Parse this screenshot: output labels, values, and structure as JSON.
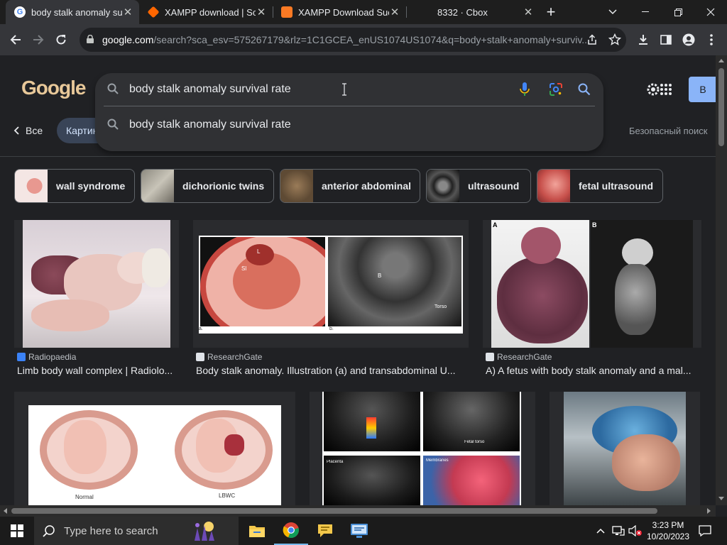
{
  "tabs": [
    {
      "title": "body stalk anomaly su",
      "close": "✕",
      "active": true
    },
    {
      "title": "XAMPP download | Sou",
      "close": "✕",
      "active": false
    },
    {
      "title": "XAMPP Download Succ",
      "close": "✕",
      "active": false
    },
    {
      "title": "8332 · Cbox",
      "close": "✕",
      "active": false
    }
  ],
  "new_tab_label": "+",
  "address_bar": {
    "domain": "google.com",
    "path": "/search?sca_esv=575267179&rlz=1C1GCEA_enUS1074US1074&q=body+stalk+anomaly+surviv..."
  },
  "search": {
    "query": "body stalk anomaly survival rate",
    "suggestion": "body stalk anomaly survival rate"
  },
  "nav": {
    "back": "Все",
    "images_tab": "Картинки",
    "safe_search": "Безопасный поиск",
    "signin": "В"
  },
  "logo_text": "Google",
  "chips": [
    {
      "label": "wall syndrome"
    },
    {
      "label": "dichorionic twins"
    },
    {
      "label": "anterior abdominal"
    },
    {
      "label": "ultrasound"
    },
    {
      "label": "fetal ultrasound"
    }
  ],
  "results": [
    {
      "source": "Radiopaedia",
      "caption": "Limb body wall complex | Radiolo..."
    },
    {
      "source": "ResearchGate",
      "caption": "Body stalk anomaly. Illustration (a) and transabdominal U..."
    },
    {
      "source": "ResearchGate",
      "caption": "A) A fetus with body stalk anomaly and a mal..."
    }
  ],
  "figure_labels": {
    "r1_left": "a.",
    "r1_right": "b.",
    "r1_torso": "Torso",
    "r1_sl": "Sl",
    "r1_l": "L",
    "r1_b": "B",
    "r3_a": "A",
    "r3_b": "B",
    "r4_normal": "Normal",
    "r4_lbwc": "LBWC",
    "r5_fetal_torso": "Fetal torso",
    "r5_membranes": "Membranes",
    "r5_placenta": "Placenta"
  },
  "taskbar": {
    "search_placeholder": "Type here to search",
    "time": "3:23 PM",
    "date": "10/20/2023"
  },
  "colors": {
    "tab_bar": "#1e1e1e",
    "toolbar": "#35363a",
    "page_bg": "#202124",
    "suggest_bg": "#303134",
    "accent_blue": "#8ab4f8"
  }
}
